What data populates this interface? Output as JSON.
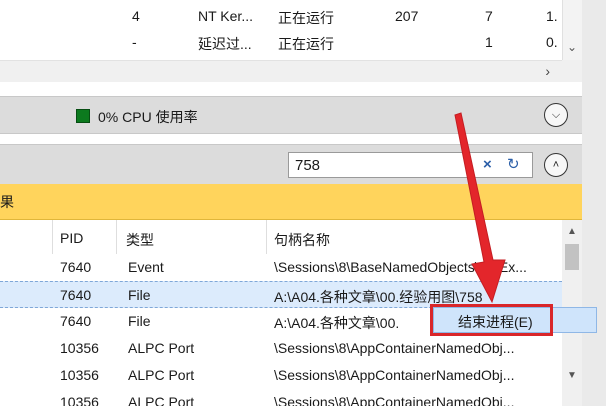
{
  "top_table": {
    "rows": [
      {
        "pid": "4",
        "name": "NT Ker...",
        "status": "正在运行",
        "handles": "207",
        "threads": "7",
        "extra": "1."
      },
      {
        "pid": "-",
        "name": "延迟过...",
        "status": "正在运行",
        "handles": "",
        "threads": "1",
        "extra": "0."
      }
    ]
  },
  "cpu_section": {
    "label": "0% CPU 使用率"
  },
  "search": {
    "value": "758",
    "clear_icon": "×",
    "refresh_icon": "↻"
  },
  "results_bar": {
    "label": "果"
  },
  "handles_table": {
    "headers": {
      "pid": "PID",
      "type": "类型",
      "name": "句柄名称"
    },
    "rows": [
      {
        "pid": "7640",
        "type": "Event",
        "name": "\\Sessions\\8\\BaseNamedObjects\\SGEx..."
      },
      {
        "pid": "7640",
        "type": "File",
        "name": "A:\\A04.各种文章\\00.经验用图\\758"
      },
      {
        "pid": "7640",
        "type": "File",
        "name": "A:\\A04.各种文章\\00."
      },
      {
        "pid": "10356",
        "type": "ALPC Port",
        "name": "\\Sessions\\8\\AppContainerNamedObj..."
      },
      {
        "pid": "10356",
        "type": "ALPC Port",
        "name": "\\Sessions\\8\\AppContainerNamedObj..."
      },
      {
        "pid": "10356",
        "type": "ALPC Port",
        "name": "\\Sessions\\8\\AppContainerNamedObj..."
      }
    ]
  },
  "context_menu": {
    "end_process": "结束进程(E)"
  },
  "colors": {
    "highlight": "#d9262a",
    "results_bar": "#ffd45c",
    "selected_row": "#dcebfc",
    "cpu_square": "#0c7a1e"
  }
}
